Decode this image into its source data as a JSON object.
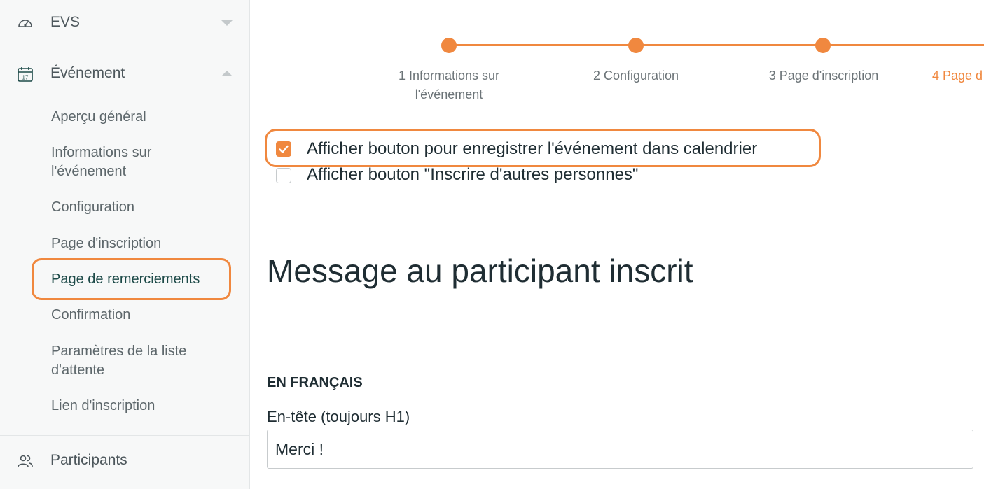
{
  "sidebar": {
    "evs": {
      "label": "EVS",
      "icon": "dashboard-gauge-icon"
    },
    "evenement": {
      "label": "Événement",
      "icon": "calendar-icon",
      "icon_day": "17"
    },
    "items": [
      {
        "label": "Aperçu général"
      },
      {
        "label": "Informations sur l'événement"
      },
      {
        "label": "Configuration"
      },
      {
        "label": "Page d'inscription"
      },
      {
        "label": "Page de remerciements",
        "active": true
      },
      {
        "label": "Confirmation"
      },
      {
        "label": "Paramètres de la liste d'attente"
      },
      {
        "label": "Lien d'inscription"
      }
    ],
    "participants": {
      "label": "Participants",
      "icon": "users-icon"
    }
  },
  "stepper": {
    "steps": [
      {
        "label": "1 Informations sur l'événement"
      },
      {
        "label": "2 Configuration"
      },
      {
        "label": "3 Page d'inscription"
      },
      {
        "label": "4 Page d"
      }
    ]
  },
  "options": {
    "calendar_button": {
      "label": "Afficher bouton pour enregistrer l'événement dans calendrier",
      "checked": true
    },
    "register_others": {
      "label": "Afficher bouton \"Inscrire d'autres personnes\"",
      "checked": false
    }
  },
  "message": {
    "title": "Message au participant inscrit",
    "section": "EN FRANÇAIS",
    "header_label": "En-tête (toujours H1)",
    "header_value": "Merci !"
  },
  "colors": {
    "accent": "#f0883f",
    "active_nav": "#1d4a48"
  }
}
